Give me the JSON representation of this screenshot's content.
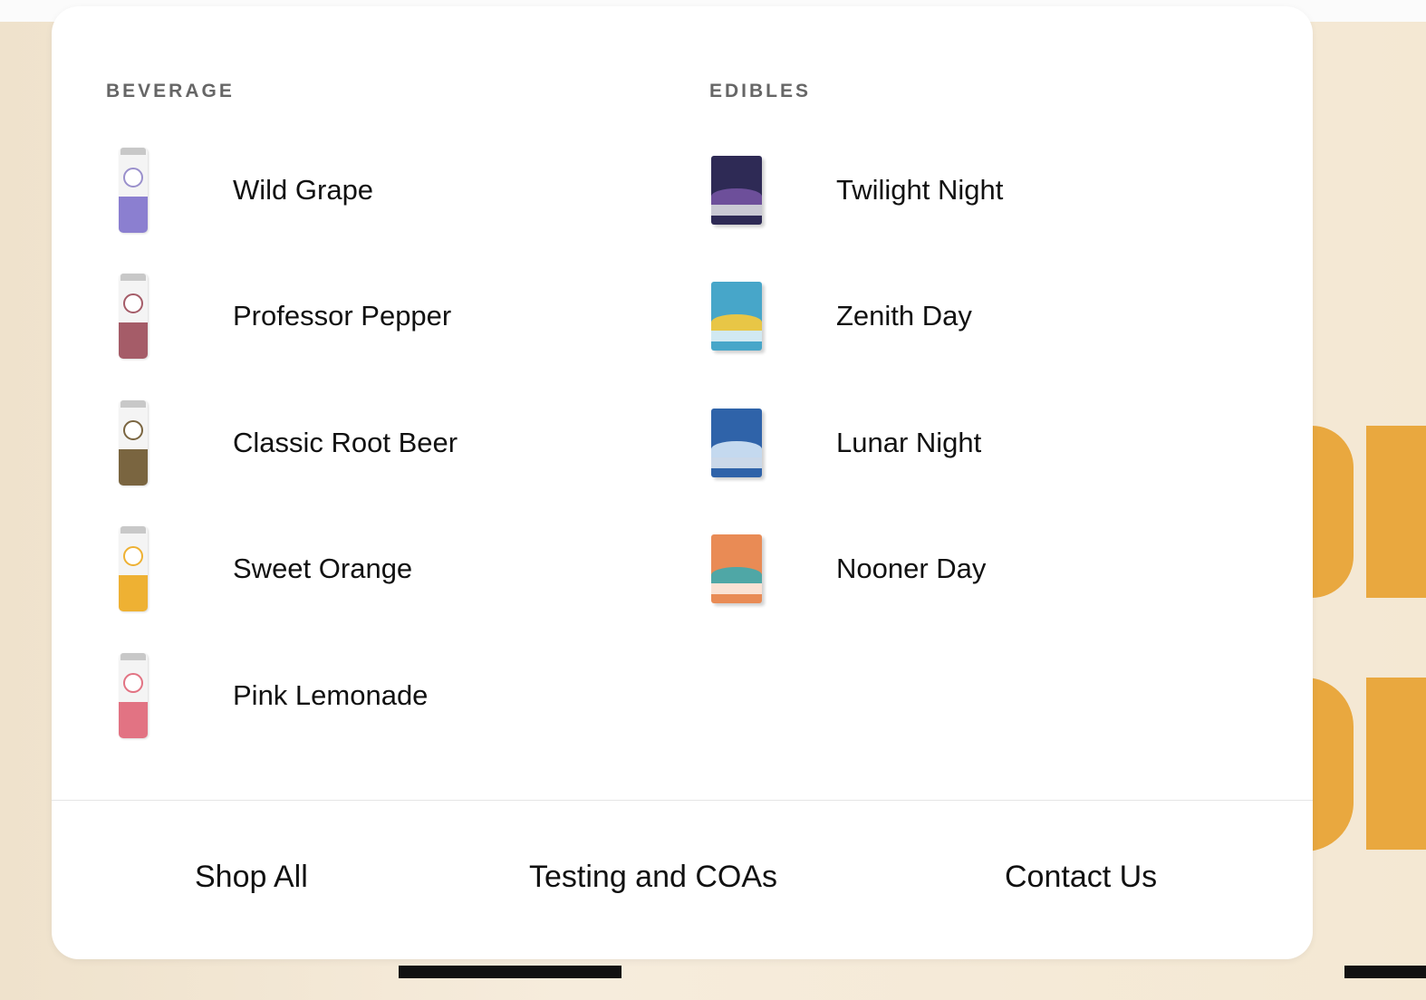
{
  "colors": {
    "accent_orange": "#e9a83f",
    "heading_gray": "#666666",
    "panel_bg": "#ffffff"
  },
  "beverage": {
    "heading": "BEVERAGE",
    "items": [
      {
        "label": "Wild Grape",
        "icon": "wild-grape-can-icon",
        "color": "#8b7fd0",
        "ring": "#9a90cc"
      },
      {
        "label": "Professor Pepper",
        "icon": "professor-pepper-can-icon",
        "color": "#a55c68",
        "ring": "#a55c68"
      },
      {
        "label": "Classic Root Beer",
        "icon": "classic-root-beer-can-icon",
        "color": "#7a6540",
        "ring": "#7a6540"
      },
      {
        "label": "Sweet Orange",
        "icon": "sweet-orange-can-icon",
        "color": "#eeb133",
        "ring": "#eeb133"
      },
      {
        "label": "Pink Lemonade",
        "icon": "pink-lemonade-can-icon",
        "color": "#e27383",
        "ring": "#e27383"
      }
    ]
  },
  "edibles": {
    "heading": "EDIBLES",
    "items": [
      {
        "label": "Twilight Night",
        "icon": "twilight-night-bag-icon",
        "color": "#2e2a55",
        "hill": "#6d4f9a"
      },
      {
        "label": "Zenith Day",
        "icon": "zenith-day-bag-icon",
        "color": "#47a6c9",
        "hill": "#e8c646"
      },
      {
        "label": "Lunar Night",
        "icon": "lunar-night-bag-icon",
        "color": "#2f63a9",
        "hill": "#c4d9ef"
      },
      {
        "label": "Nooner Day",
        "icon": "nooner-day-bag-icon",
        "color": "#e98b55",
        "hill": "#4fa7a6"
      }
    ]
  },
  "footer": {
    "links": [
      "Shop All",
      "Testing and COAs",
      "Contact Us"
    ]
  }
}
